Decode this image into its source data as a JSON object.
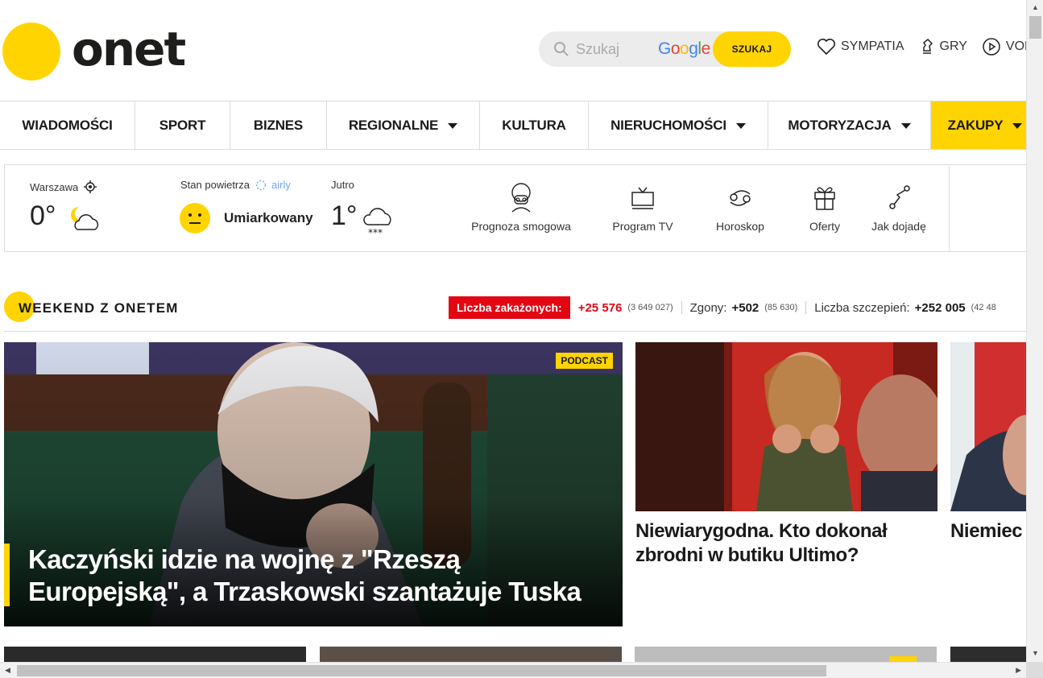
{
  "header": {
    "logo_text": "onet",
    "search_placeholder": "Szukaj",
    "google_label": "Google",
    "search_button": "SZUKAJ",
    "links": [
      {
        "label": "SYMPATIA",
        "icon": "heart-icon"
      },
      {
        "label": "GRY",
        "icon": "chess-knight-icon"
      },
      {
        "label": "VOD",
        "icon": "play-icon"
      }
    ]
  },
  "nav": {
    "items": [
      {
        "label": "WIADOMOŚCI",
        "dropdown": false
      },
      {
        "label": "SPORT",
        "dropdown": false
      },
      {
        "label": "BIZNES",
        "dropdown": false
      },
      {
        "label": "REGIONALNE",
        "dropdown": true
      },
      {
        "label": "KULTURA",
        "dropdown": false
      },
      {
        "label": "NIERUCHOMOŚCI",
        "dropdown": true
      },
      {
        "label": "MOTORYZACJA",
        "dropdown": true
      },
      {
        "label": "ZAKUPY",
        "dropdown": true
      }
    ]
  },
  "weather": {
    "city": "Warszawa",
    "temp": "0°",
    "air_label": "Stan powietrza",
    "air_provider": "airly",
    "air_status": "Umiarkowany",
    "tomorrow_label": "Jutro",
    "tomorrow_temp": "1°",
    "services": [
      {
        "label": "Prognoza smogowa",
        "icon": "smog-mask-icon"
      },
      {
        "label": "Program TV",
        "icon": "tv-icon"
      },
      {
        "label": "Horoskop",
        "icon": "cancer-zodiac-icon"
      },
      {
        "label": "Oferty",
        "icon": "gift-icon"
      },
      {
        "label": "Jak dojadę",
        "icon": "route-icon"
      }
    ]
  },
  "section": {
    "title": "WEEKEND Z ONETEM",
    "covid": {
      "label": "Liczba zakażonych:",
      "infected_new": "+25 576",
      "infected_total": "(3 649 027)",
      "deaths_label": "Zgony:",
      "deaths_new": "+502",
      "deaths_total": "(85 630)",
      "vacc_label": "Liczba szczepień:",
      "vacc_new": "+252 005",
      "vacc_total": "(42 48"
    }
  },
  "stories": {
    "main": {
      "badge": "PODCAST",
      "title": "Kaczyński idzie na wojnę z \"Rzeszą Europejską\", a Trzaskowski szantażuje Tuska"
    },
    "second": {
      "title": "Niewiarygodna. Kto dokonał zbrodni w butiku Ultimo?"
    },
    "third": {
      "title": "Niemiec większoś"
    }
  },
  "colors": {
    "brand_yellow": "#ffd400",
    "covid_red": "#e30613"
  }
}
